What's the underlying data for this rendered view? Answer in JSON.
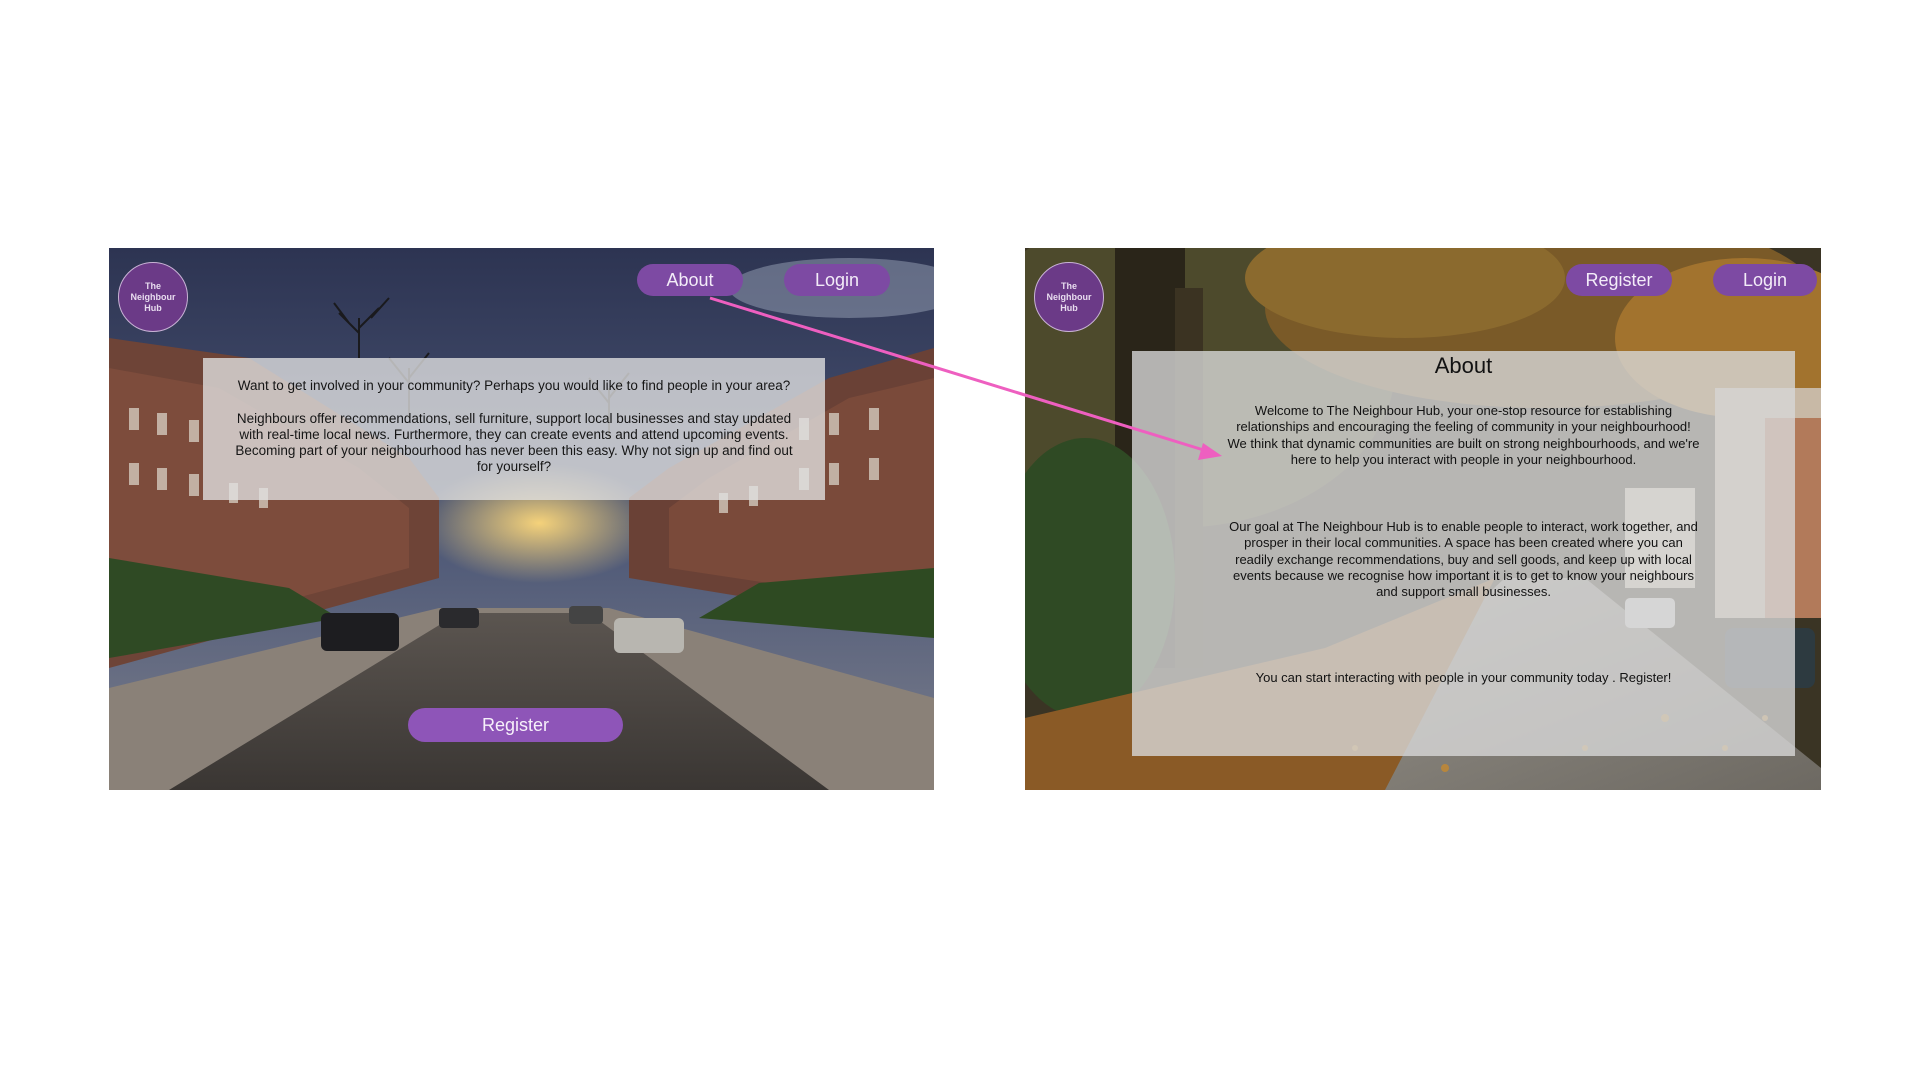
{
  "home": {
    "logo": "The Neighbour Hub",
    "nav": {
      "about": "About",
      "login": "Login"
    },
    "card": {
      "question": "Want to get involved in your community? Perhaps you would like to find people in your area?",
      "paragraph": "Neighbours offer recommendations, sell furniture, support local businesses and stay updated with real-time local news. Furthermore, they can create events and attend upcoming events. Becoming part of your neighbourhood has never been this easy. Why not sign up and find out for yourself?"
    },
    "register": "Register"
  },
  "about": {
    "logo": "The Neighbour Hub",
    "nav": {
      "register": "Register",
      "login": "Login"
    },
    "title": "About",
    "p1": "Welcome to The Neighbour Hub, your one-stop resource for establishing relationships and encouraging the feeling of community in your neighbourhood! We think that dynamic communities are built on strong neighbourhoods, and we're here to help you interact with people in your neighbourhood.",
    "p2": "Our goal at The Neighbour Hub is to enable people to interact, work together, and prosper in their local communities. A space has been created where you can readily exchange recommendations, buy and sell goods, and keep up with local events because we recognise how important it is to get to know your neighbours and support small businesses.",
    "p3": "You can start interacting with people in your community today . Register!"
  },
  "colors": {
    "brand_purple": "#7d4aa3",
    "logo_purple": "#6b3a87",
    "arrow_pink": "#ee5fc0"
  },
  "icons": {
    "flow_arrow": "arrow-icon"
  }
}
